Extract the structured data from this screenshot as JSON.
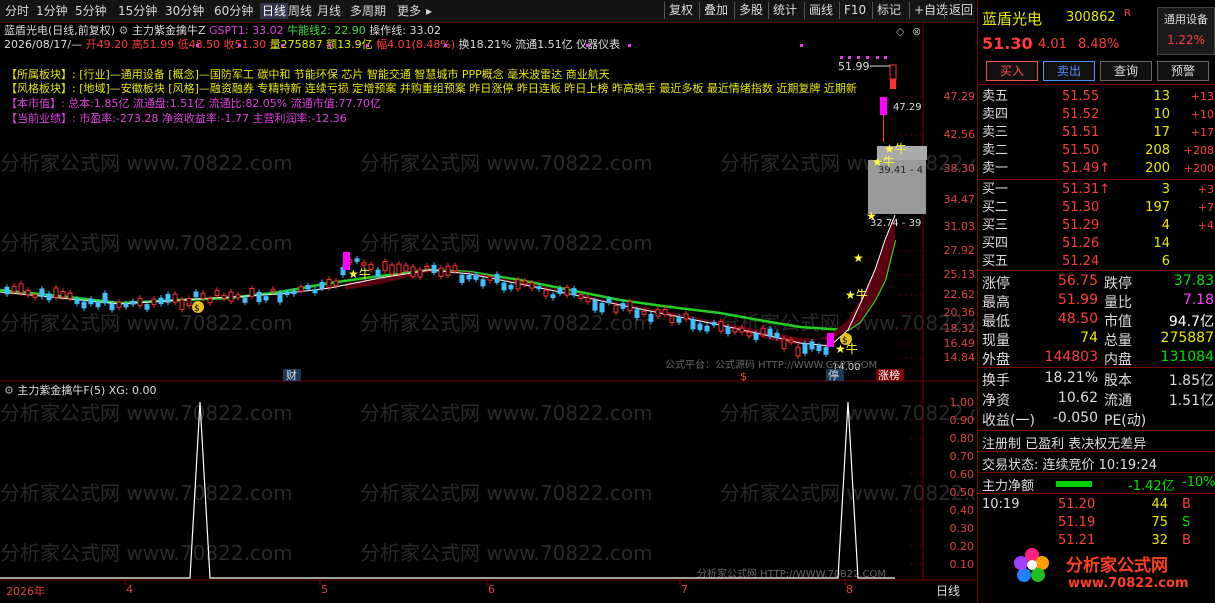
{
  "toolbar": {
    "left": [
      "分时",
      "1分钟",
      "5分钟",
      "15分钟",
      "30分钟",
      "60分钟",
      "日线",
      "周线",
      "月线",
      "多周期",
      "更多"
    ],
    "active": "日线",
    "right": [
      "复权",
      "叠加",
      "多股",
      "统计",
      "画线",
      "F10",
      "标记",
      "+自选",
      "返回"
    ]
  },
  "chart": {
    "title": "蓝盾光电(日线,前复权)",
    "indicator": "主力紫金擒牛Z",
    "gspt": "GSPT1: 33.02",
    "niuneng": "牛能线2: 22.90",
    "caozuo": "操作线: 33.02",
    "info_date": "2026/08/17/—",
    "info_open": "开49.20",
    "info_high": "高51.99",
    "info_low": "低48.50",
    "info_close": "收51.30",
    "info_vol": "量275887",
    "info_amt": "额13.9亿",
    "info_amp": "幅4.01(8.48%)",
    "info_turn": "换18.21%",
    "info_float": "流通1.51亿",
    "info_tag": "仪器仪表",
    "sector1_label": "【所属板块】:",
    "sector1_text": "[行业]—通用设备 [概念]—国防军工 碳中和 节能环保 芯片 智能交通 智慧城市 PPP概念 毫米波雷达 商业航天",
    "sector2_label": "【风格板块】:",
    "sector2_text": "[地域]—安徽板块 [风格]—融资融券 专精特新 连续亏损 定增预案 并购重组预案 昨日涨停 昨日连板 昨日上榜 昨高换手 最近多板 最近情绪指数 近期复牌 近期新",
    "mv_label": "【本市值】:",
    "mv_text": "总本:1.85亿 流通盘:1.51亿 流通比:82.05% 流通市值:77.70亿",
    "perf_label": "【当前业绩】:",
    "perf_text": "市盈率:-273.28 净资收益率:-1.77 主营利润率:-12.36",
    "ann_high": "51.99",
    "ann_low": "14.00",
    "ann_box1": "39.41 - 4",
    "ann_box2": "32.74 - 39",
    "marker_cai": "财",
    "marker_s": "$",
    "marker_ting": "停",
    "marker_zhangbang": "涨榜",
    "watermark1": "公式平台：公式源码 HTTP://WWW.GSPT.COM",
    "watermark2": "分析家公式网 HTTP://WWW.70822.COM",
    "watermark_bg": "分析家公式网 www.70822.com",
    "yaxis": [
      "47.29",
      "42.56",
      "38.30",
      "34.47",
      "31.03",
      "27.92",
      "25.13",
      "22.62",
      "20.36",
      "18.32",
      "16.49",
      "14.84"
    ],
    "label_4729": "47.29"
  },
  "sub": {
    "title": "主力紫金擒牛F(5) XG: 0.00",
    "yaxis": [
      "1.00",
      "0.90",
      "0.80",
      "0.70",
      "0.60",
      "0.50",
      "0.40",
      "0.30",
      "0.20",
      "0.10"
    ]
  },
  "xaxis": {
    "labels": [
      "2026年",
      "4",
      "5",
      "6",
      "7",
      "8"
    ],
    "period": "日线"
  },
  "right": {
    "name": "蓝盾光电",
    "code": "300862",
    "code_badge": "R",
    "industry": "通用设备",
    "industry_pct": "1.22%",
    "price": "51.30",
    "change": "4.01",
    "pct": "8.48%",
    "buttons": [
      "买入",
      "卖出",
      "查询",
      "预警"
    ],
    "asks": [
      {
        "n": "卖五",
        "p": "51.55",
        "v": "13",
        "c": "+13"
      },
      {
        "n": "卖四",
        "p": "51.52",
        "v": "10",
        "c": "+10"
      },
      {
        "n": "卖三",
        "p": "51.51",
        "v": "17",
        "c": "+17"
      },
      {
        "n": "卖二",
        "p": "51.50",
        "v": "208",
        "c": "+208"
      },
      {
        "n": "卖一",
        "p": "51.49↑",
        "v": "200",
        "c": "+200"
      }
    ],
    "bids": [
      {
        "n": "买一",
        "p": "51.31↑",
        "v": "3",
        "c": "+3"
      },
      {
        "n": "买二",
        "p": "51.30",
        "v": "197",
        "c": "+7"
      },
      {
        "n": "买三",
        "p": "51.29",
        "v": "4",
        "c": "+4"
      },
      {
        "n": "买四",
        "p": "51.26",
        "v": "14",
        "c": ""
      },
      {
        "n": "买五",
        "p": "51.24",
        "v": "6",
        "c": ""
      }
    ],
    "stats": [
      {
        "l": "涨停",
        "lv": "56.75",
        "r": "跌停",
        "rv": "37.83",
        "lc": "red",
        "rc": "grn"
      },
      {
        "l": "最高",
        "lv": "51.99",
        "r": "量比",
        "rv": "7.18",
        "lc": "red",
        "rc": "mag"
      },
      {
        "l": "最低",
        "lv": "48.50",
        "r": "市值",
        "rv": "94.7亿",
        "lc": "red",
        "rc": "wht"
      },
      {
        "l": "现量",
        "lv": "74",
        "r": "总量",
        "rv": "275887",
        "lc": "yel",
        "rc": "yel"
      },
      {
        "l": "外盘",
        "lv": "144803",
        "r": "内盘",
        "rv": "131084",
        "lc": "red",
        "rc": "grn"
      }
    ],
    "stats2": [
      {
        "l": "换手",
        "lv": "18.21%",
        "r": "股本",
        "rv": "1.85亿"
      },
      {
        "l": "净资",
        "lv": "10.62",
        "r": "流通",
        "rv": "1.51亿"
      },
      {
        "l": "收益(一)",
        "lv": "-0.050",
        "r": "PE(动)",
        "rv": ""
      }
    ],
    "reg": "注册制 已盈利 表决权无差异",
    "trade_state": "交易状态: 连续竞价 10:19:24",
    "main_flow_label": "主力净额",
    "main_flow_val": "-1.42亿",
    "main_flow_pct": "-10%",
    "ticks": [
      {
        "t": "10:19",
        "p": "51.20",
        "v": "44",
        "d": "B"
      },
      {
        "t": "",
        "p": "51.19",
        "v": "75",
        "d": "S"
      },
      {
        "t": "",
        "p": "51.21",
        "v": "32",
        "d": "B"
      }
    ],
    "logo_text": "分析家公式网",
    "logo_url": "www.70822.com"
  }
}
